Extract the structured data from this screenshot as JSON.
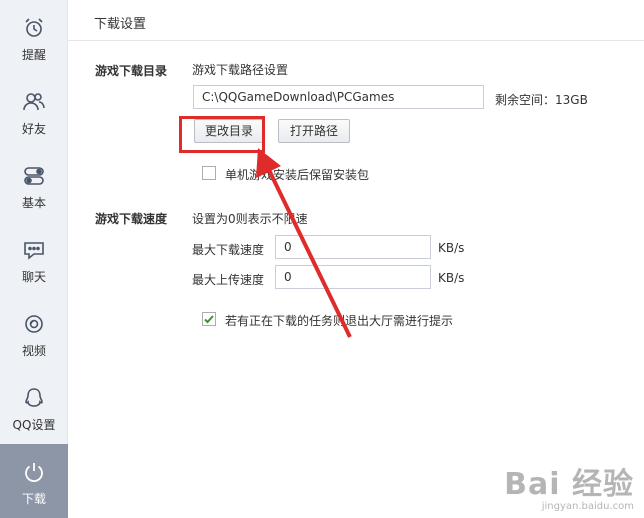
{
  "sidebar": {
    "items": [
      {
        "label": "提醒",
        "icon": "alarm-clock-icon"
      },
      {
        "label": "好友",
        "icon": "friends-icon"
      },
      {
        "label": "基本",
        "icon": "toggle-settings-icon"
      },
      {
        "label": "聊天",
        "icon": "chat-bubble-icon"
      },
      {
        "label": "视频",
        "icon": "video-camera-icon"
      },
      {
        "label": "QQ设置",
        "icon": "qq-penguin-icon"
      },
      {
        "label": "下载",
        "icon": "power-download-icon",
        "active": true
      }
    ]
  },
  "header": {
    "title": "下载设置"
  },
  "download_dir": {
    "section_label": "游戏下载目录",
    "subtitle": "游戏下载路径设置",
    "path_value": "C:\\QQGameDownload\\PCGames",
    "remaining_space": "剩余空间：13GB",
    "change_button": "更改目录",
    "open_button": "打开路径",
    "keep_package_label": "单机游戏安装后保留安装包",
    "keep_package_checked": false
  },
  "download_speed": {
    "section_label": "游戏下载速度",
    "hint": "设置为0则表示不限速",
    "max_download_label": "最大下载速度",
    "max_download_value": "0",
    "max_upload_label": "最大上传速度",
    "max_upload_value": "0",
    "unit": "KB/s",
    "exit_prompt_label": "若有正在下载的任务则退出大厅需进行提示",
    "exit_prompt_checked": true
  },
  "watermark": {
    "top": "Bai 经验",
    "bottom": "jingyan.baidu.com"
  },
  "colors": {
    "sidebar_bg": "#eef1f5",
    "active_bg": "#8c96a6",
    "highlight": "#e02b2b",
    "check": "#3a8f3a"
  }
}
